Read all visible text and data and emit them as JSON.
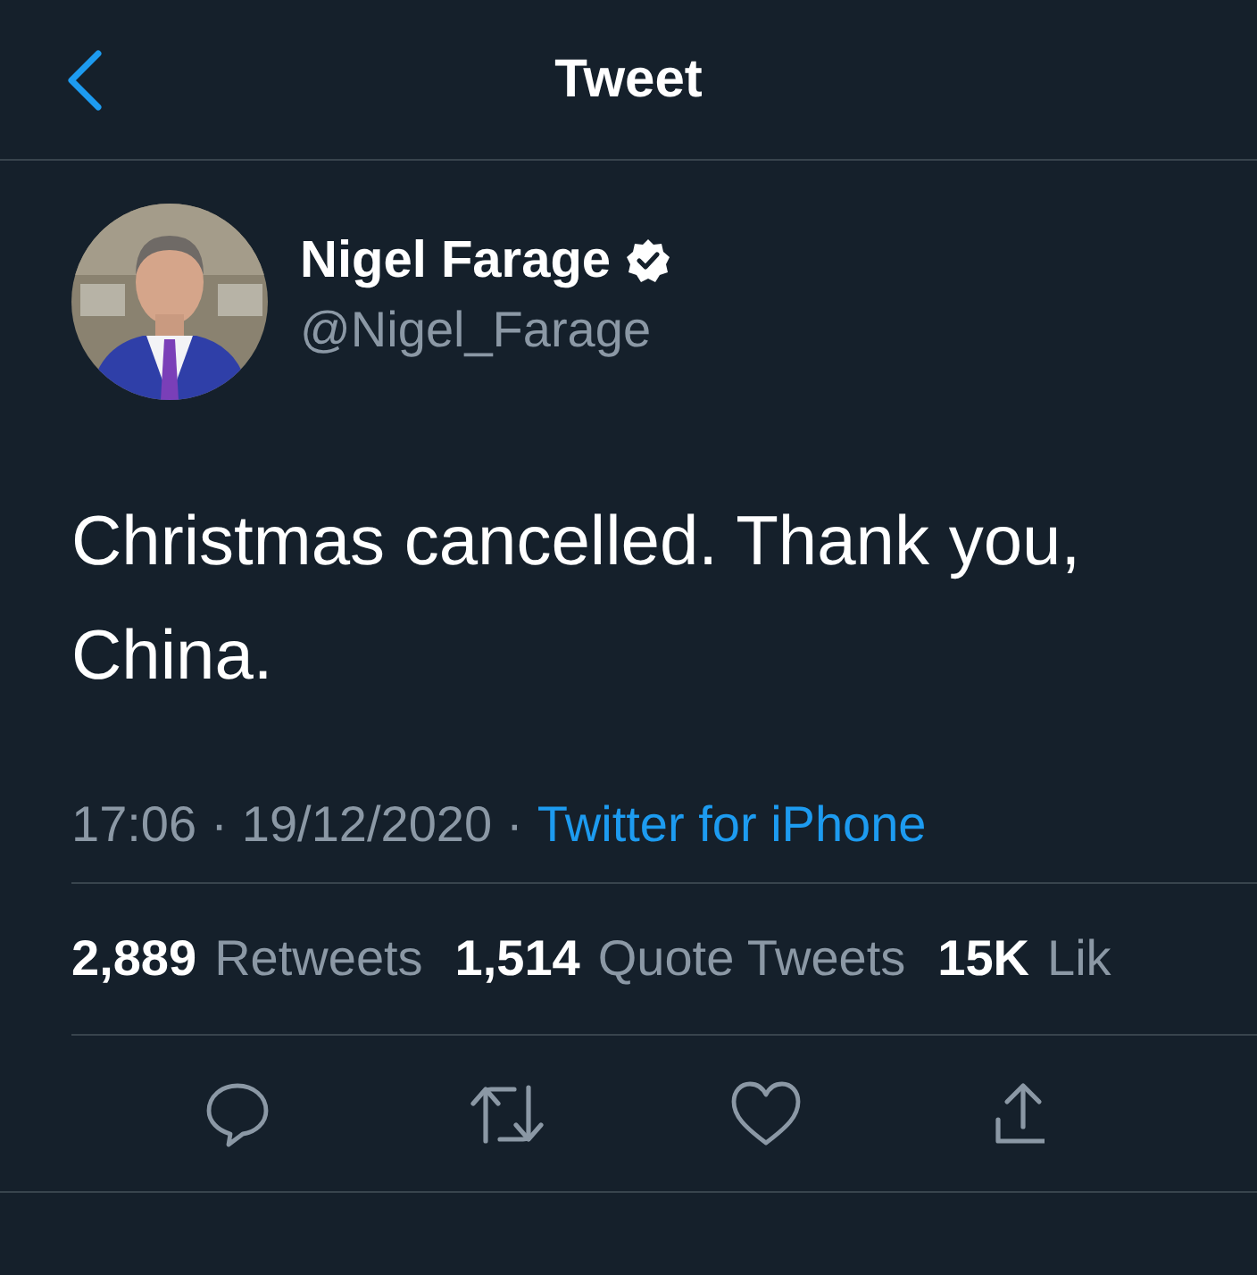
{
  "header": {
    "title": "Tweet"
  },
  "author": {
    "name": "Nigel Farage",
    "verified": true,
    "handle": "@Nigel_Farage"
  },
  "tweet": {
    "text": "Christmas cancelled. Thank you, China."
  },
  "meta": [
    {
      "kind": "time",
      "text": "17:06"
    },
    {
      "kind": "separator",
      "text": "·"
    },
    {
      "kind": "date",
      "text": "19/12/2020"
    },
    {
      "kind": "separator",
      "text": "·"
    },
    {
      "kind": "link",
      "text": "Twitter for iPhone"
    }
  ],
  "stats": [
    {
      "count": "2,889",
      "label": "Retweets"
    },
    {
      "count": "1,514",
      "label": "Quote Tweets"
    },
    {
      "count": "15K",
      "label": "Lik"
    }
  ],
  "actions": [
    {
      "kind": "reply"
    },
    {
      "kind": "retweet"
    },
    {
      "kind": "like"
    },
    {
      "kind": "share"
    }
  ]
}
